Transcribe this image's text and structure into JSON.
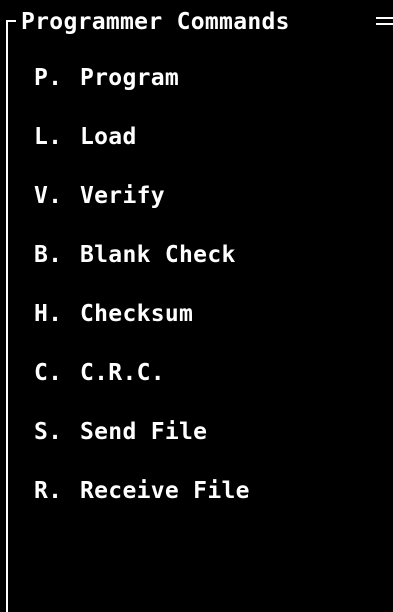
{
  "menu": {
    "title": "Programmer Commands",
    "items": [
      {
        "key": "P.",
        "label": "Program"
      },
      {
        "key": "L.",
        "label": "Load"
      },
      {
        "key": "V.",
        "label": "Verify"
      },
      {
        "key": "B.",
        "label": "Blank Check"
      },
      {
        "key": "H.",
        "label": "Checksum"
      },
      {
        "key": "C.",
        "label": "C.R.C."
      },
      {
        "key": "S.",
        "label": "Send File"
      },
      {
        "key": "R.",
        "label": "Receive File"
      }
    ]
  },
  "colors": {
    "background": "#000000",
    "foreground": "#ffffff"
  }
}
